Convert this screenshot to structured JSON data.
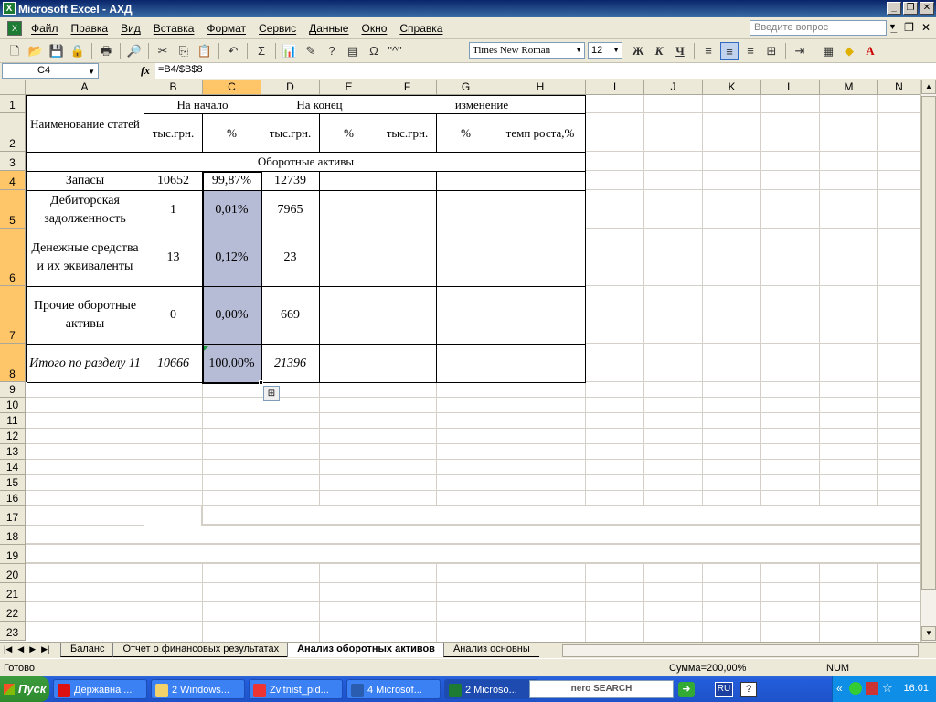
{
  "window": {
    "title": "Microsoft Excel - АХД",
    "app_icon": "excel-icon"
  },
  "menu": {
    "items": [
      "Файл",
      "Правка",
      "Вид",
      "Вставка",
      "Формат",
      "Сервис",
      "Данные",
      "Окно",
      "Справка"
    ],
    "help_placeholder": "Введите вопрос"
  },
  "toolbar": {
    "font_name": "Times New Roman",
    "font_size": "12",
    "bold": "Ж",
    "italic": "К",
    "underline": "Ч",
    "sum": "Σ",
    "omega": "Ω",
    "quote_btn": "\"^\""
  },
  "formula": {
    "cell_ref": "C4",
    "fx": "fx",
    "content": "=B4/$B$8"
  },
  "columns": [
    "A",
    "B",
    "C",
    "D",
    "E",
    "F",
    "G",
    "H",
    "I",
    "J",
    "K",
    "L",
    "M",
    "N"
  ],
  "rows": [
    "1",
    "2",
    "3",
    "4",
    "5",
    "6",
    "7",
    "8",
    "9",
    "10",
    "11",
    "12",
    "13",
    "14",
    "15",
    "16",
    "17",
    "18",
    "19",
    "20",
    "21",
    "22",
    "23"
  ],
  "table": {
    "header_item": "Наименование статей",
    "group_start": "На начало",
    "group_end": "На конец",
    "group_change": "изменение",
    "sub_thous_b": "тыс.грн.",
    "sub_pct_c": "%",
    "sub_thous_d": "тыс.грн.",
    "sub_pct_e": "%",
    "sub_thous_f": "тыс.грн.",
    "sub_pct_g": "%",
    "sub_growth": "темп роста,%",
    "section": "Оборотные активы",
    "data_rows": [
      {
        "name": "Запасы",
        "b": "10652",
        "c": "99,87%",
        "d": "12739"
      },
      {
        "name": "Дебиторская задолженность",
        "b": "1",
        "c": "0,01%",
        "d": "7965"
      },
      {
        "name": "Денежные средства и их эквиваленты",
        "b": "13",
        "c": "0,12%",
        "d": "23"
      },
      {
        "name": "Прочие оборотные активы",
        "b": "0",
        "c": "0,00%",
        "d": "669"
      },
      {
        "name": "Итого по разделу 11",
        "b": "10666",
        "c": "100,00%",
        "d": "21396"
      }
    ]
  },
  "sheets": {
    "tabs": [
      "Баланс",
      "Отчет о финансовых результатах",
      "Анализ оборотных активов",
      "Анализ основны"
    ],
    "active": "Анализ оборотных активов"
  },
  "status": {
    "ready": "Готово",
    "sum": "Сумма=200,00%",
    "num": "NUM"
  },
  "taskbar": {
    "start": "Пуск",
    "buttons": [
      "Державна ...",
      "2 Windows...",
      "Zvitnist_pid...",
      "4 Microsof...",
      "2 Microso..."
    ],
    "nero": "nero SEARCH",
    "lang": "RU",
    "clock": "16:01"
  }
}
